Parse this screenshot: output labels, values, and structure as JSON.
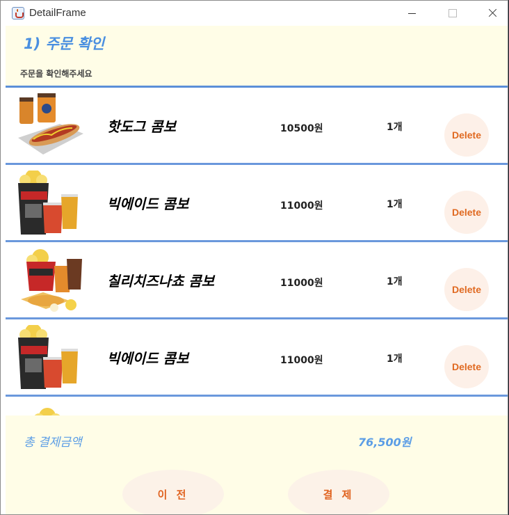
{
  "window": {
    "title": "DetailFrame"
  },
  "header": {
    "title": "1) 주문 확인",
    "subtitle": "주문을 확인해주세요"
  },
  "items": [
    {
      "name": "핫도그 콤보",
      "price": "10500원",
      "qty": "1개",
      "delete_label": "Delete",
      "image": "hotdog-combo"
    },
    {
      "name": "빅에이드 콤보",
      "price": "11000원",
      "qty": "1개",
      "delete_label": "Delete",
      "image": "big-ade-combo"
    },
    {
      "name": "칠리치즈나쵸 콤보",
      "price": "11000원",
      "qty": "1개",
      "delete_label": "Delete",
      "image": "chili-nacho-combo"
    },
    {
      "name": "빅에이드 콤보",
      "price": "11000원",
      "qty": "1개",
      "delete_label": "Delete",
      "image": "big-ade-combo"
    }
  ],
  "footer": {
    "total_label": "총 결제금액",
    "total_value": "76,500원",
    "prev_label": "이 전",
    "pay_label": "결 제"
  },
  "colors": {
    "accent": "#4a8fe0",
    "divider": "#6a98dc",
    "background": "#fffde7",
    "button_text": "#e06a22"
  }
}
